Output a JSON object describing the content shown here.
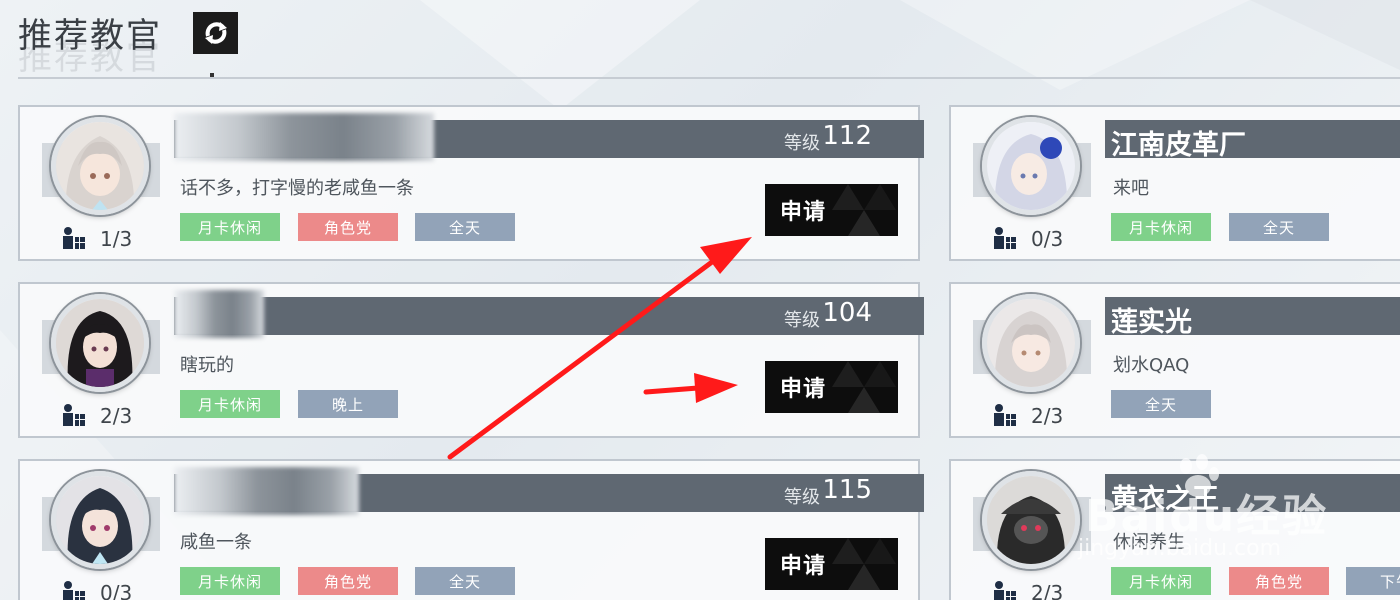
{
  "header": {
    "title": "推荐教官"
  },
  "instructors_left": [
    {
      "level_label": "等级",
      "level": "112",
      "bio": "话不多，打字慢的老咸鱼一条",
      "members": "1/3",
      "tags": [
        "月卡休闲",
        "角色党",
        "全天"
      ],
      "apply_label": "申请"
    },
    {
      "level_label": "等级",
      "level": "104",
      "bio": "瞎玩的",
      "members": "2/3",
      "tags": [
        "月卡休闲",
        "晚上"
      ],
      "apply_label": "申请"
    },
    {
      "level_label": "等级",
      "level": "115",
      "bio": "咸鱼一条",
      "members": "0/3",
      "tags": [
        "月卡休闲",
        "角色党",
        "全天"
      ],
      "apply_label": "申请"
    }
  ],
  "instructors_right": [
    {
      "name": "江南皮革厂",
      "bio": "来吧",
      "members": "0/3",
      "tags": [
        "月卡休闲",
        "全天"
      ]
    },
    {
      "name": "莲实光",
      "bio": "划水QAQ",
      "members": "2/3",
      "tags": [
        "全天"
      ]
    },
    {
      "name": "黄衣之王",
      "bio": "休闲养生",
      "members": "2/3",
      "tags": [
        "月卡休闲",
        "角色党",
        "下午"
      ]
    }
  ],
  "tag_colors": {
    "月卡休闲": "#7fd18a",
    "角色党": "#ec8a8a",
    "全天": "#92a3b8",
    "晚上": "#92a3b8",
    "下午": "#92a3b8"
  },
  "icons": {
    "refresh": "refresh-icon",
    "members": "members-icon"
  },
  "watermark": {
    "logo": "Baidu经验",
    "url": "jingyan.baidu.com"
  },
  "colors": {
    "name_bar": "#5f6872",
    "apply_button": "#0d0d0d",
    "annotation_arrow": "#ff1a1a"
  }
}
